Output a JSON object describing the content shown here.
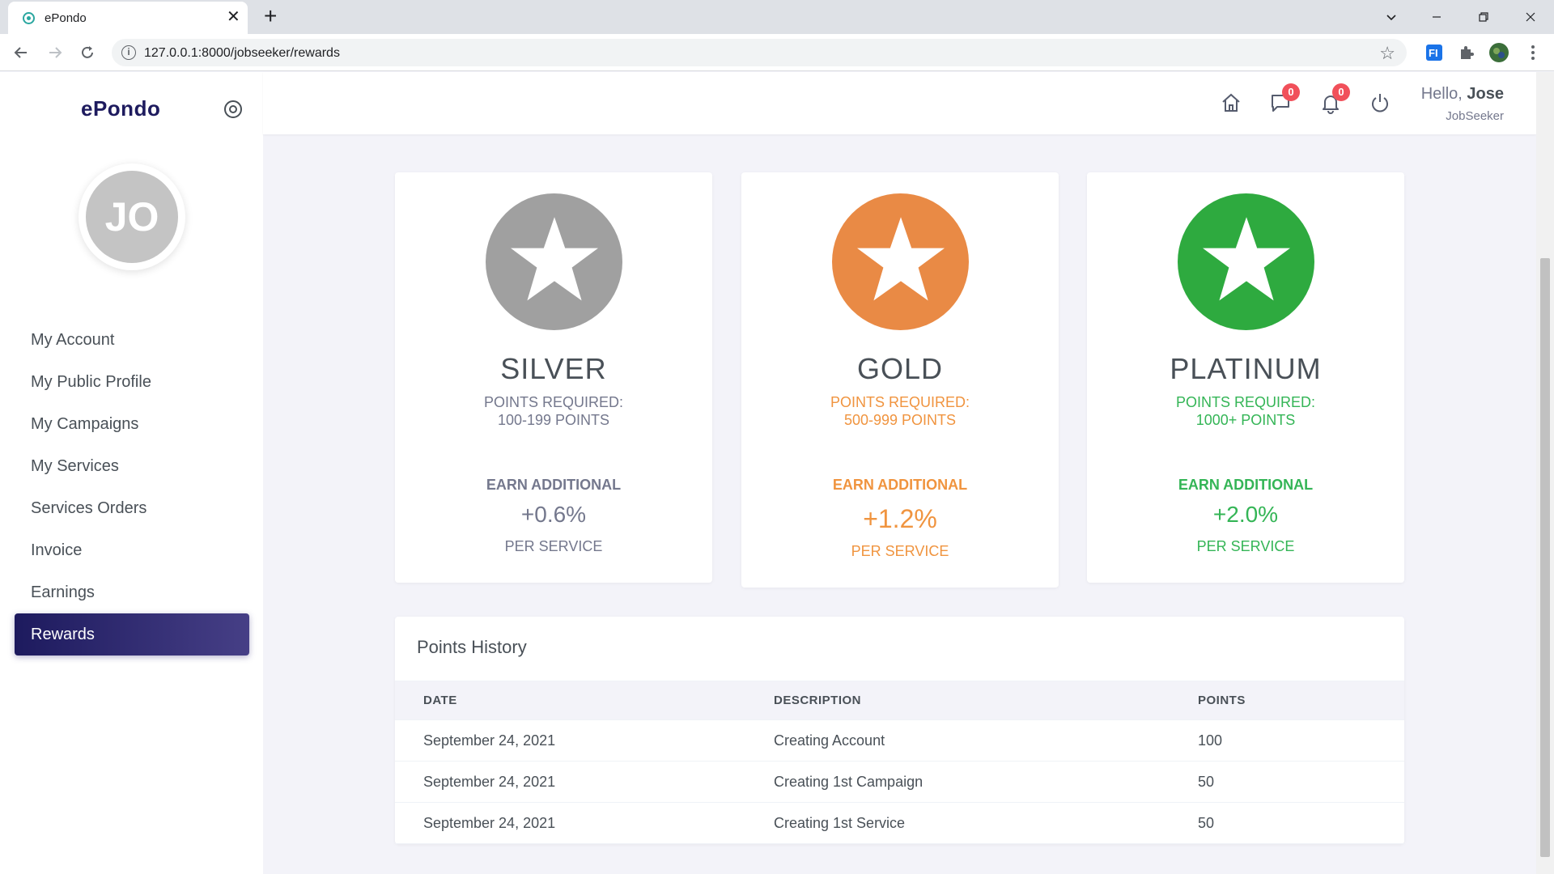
{
  "browser": {
    "tab_title": "ePondo",
    "url": "127.0.0.1:8000/jobseeker/rewards"
  },
  "sidebar": {
    "brand": "ePondo",
    "avatar_initials": "JO",
    "items": [
      {
        "label": "My Account"
      },
      {
        "label": "My Public Profile"
      },
      {
        "label": "My Campaigns"
      },
      {
        "label": "My Services"
      },
      {
        "label": "Services Orders"
      },
      {
        "label": "Invoice"
      },
      {
        "label": "Earnings"
      },
      {
        "label": "Rewards"
      }
    ],
    "active_item": "Rewards"
  },
  "header": {
    "messages_count": "0",
    "notifications_count": "0",
    "greeting": "Hello,",
    "user_name": "Jose",
    "role": "JobSeeker"
  },
  "tiers": [
    {
      "name": "SILVER",
      "req_line1": "POINTS REQUIRED:",
      "req_line2": "100-199 POINTS",
      "earn": "EARN ADDITIONAL",
      "percent": "+0.6%",
      "per": "PER SERVICE",
      "color": "#a0a0a0",
      "text_color": "#74788d"
    },
    {
      "name": "GOLD",
      "req_line1": "POINTS REQUIRED:",
      "req_line2": "500-999 POINTS",
      "earn": "EARN ADDITIONAL",
      "percent": "+1.2%",
      "per": "PER SERVICE",
      "color": "#e98a45",
      "text_color": "#f0943f"
    },
    {
      "name": "PLATINUM",
      "req_line1": "POINTS REQUIRED:",
      "req_line2": "1000+ POINTS",
      "earn": "EARN ADDITIONAL",
      "percent": "+2.0%",
      "per": "PER SERVICE",
      "color": "#2eaa3f",
      "text_color": "#34b556"
    }
  ],
  "history": {
    "title": "Points History",
    "columns": [
      "DATE",
      "DESCRIPTION",
      "POINTS"
    ],
    "rows": [
      {
        "date": "September 24, 2021",
        "description": "Creating Account",
        "points": "100"
      },
      {
        "date": "September 24, 2021",
        "description": "Creating 1st Campaign",
        "points": "50"
      },
      {
        "date": "September 24, 2021",
        "description": "Creating 1st Service",
        "points": "50"
      }
    ]
  }
}
